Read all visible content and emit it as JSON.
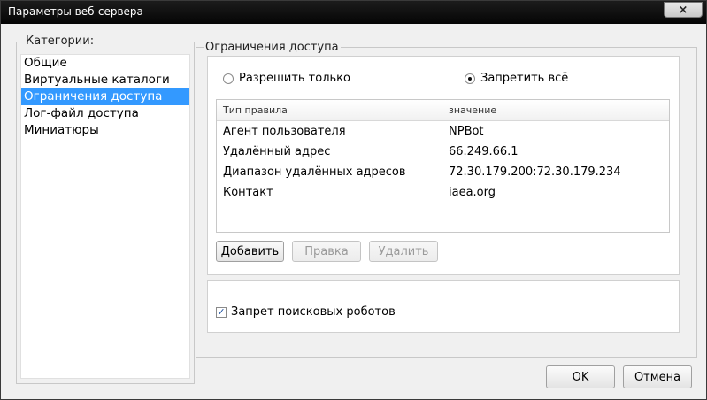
{
  "window": {
    "title": "Параметры веб-сервера",
    "close_icon": "×"
  },
  "categories": {
    "legend": "Категории:",
    "items": [
      {
        "label": "Общие",
        "selected": false
      },
      {
        "label": "Виртуальные каталоги",
        "selected": false
      },
      {
        "label": "Ограничения доступа",
        "selected": true
      },
      {
        "label": "Лог-файл доступа",
        "selected": false
      },
      {
        "label": "Миниатюры",
        "selected": false
      }
    ]
  },
  "access": {
    "legend": "Ограничения доступа",
    "radio_allow_label": "Разрешить только",
    "radio_deny_label": "Запретить всё",
    "radio_selected": "deny",
    "table": {
      "headers": [
        "Тип правила",
        "значение"
      ],
      "rows": [
        [
          "Агент пользователя",
          "NPBot"
        ],
        [
          "Удалённый адрес",
          "66.249.66.1"
        ],
        [
          "Диапазон удалённых адресов",
          "72.30.179.200:72.30.179.234"
        ],
        [
          "Контакт",
          "iaea.org"
        ]
      ]
    },
    "buttons": {
      "add": "Добавить",
      "edit": "Правка",
      "delete": "Удалить"
    },
    "robots_label": "Запрет поисковых роботов",
    "robots_checked": true,
    "check_glyph": "✓"
  },
  "footer": {
    "ok": "OK",
    "cancel": "Отмена"
  },
  "colors": {
    "selection": "#3399ff",
    "titlebar": "#0a0a0a"
  }
}
